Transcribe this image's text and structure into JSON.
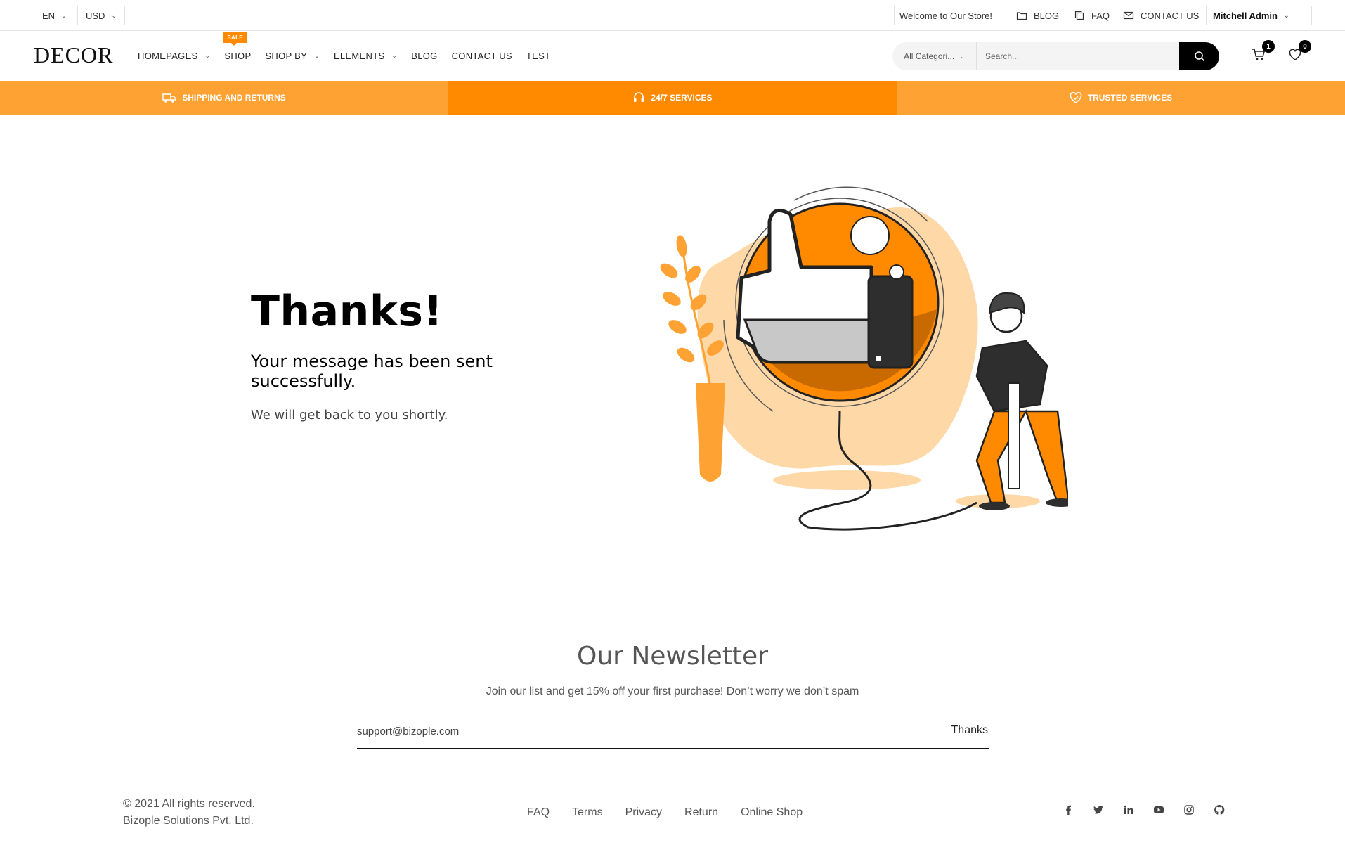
{
  "topbar": {
    "language": "EN",
    "currency": "USD",
    "welcome": "Welcome to Our Store!",
    "blog": "BLOG",
    "faq": "FAQ",
    "contact": "CONTACT US",
    "user": "Mitchell Admin"
  },
  "header": {
    "logo": "DECOR",
    "nav": [
      {
        "label": "HOMEPAGES",
        "dropdown": true
      },
      {
        "label": "SHOP",
        "badge": "SALE"
      },
      {
        "label": "SHOP BY",
        "dropdown": true
      },
      {
        "label": "ELEMENTS",
        "dropdown": true
      },
      {
        "label": "BLOG"
      },
      {
        "label": "CONTACT US"
      },
      {
        "label": "TEST"
      }
    ],
    "search": {
      "category": "All Categori...",
      "placeholder": "Search..."
    },
    "cart_count": "1",
    "wishlist_count": "0"
  },
  "services": [
    "SHIPPING AND RETURNS",
    "24/7 SERVICES",
    "TRUSTED SERVICES"
  ],
  "hero": {
    "title": "Thanks!",
    "message": "Your message has been sent successfully.",
    "sub": "We will get back to you shortly."
  },
  "newsletter": {
    "title": "Our Newsletter",
    "subtitle": "Join our list and get 15% off your first purchase! Don’t worry we don’t spam",
    "email_value": "support@bizople.com",
    "button": "Thanks"
  },
  "footer": {
    "copyright_1": "© 2021 All rights reserved.",
    "copyright_2": "Bizople Solutions Pvt. Ltd.",
    "links": [
      "FAQ",
      "Terms",
      "Privacy",
      "Return",
      "Online Shop"
    ],
    "social": [
      "facebook-icon",
      "twitter-icon",
      "linkedin-icon",
      "youtube-icon",
      "instagram-icon",
      "github-icon"
    ]
  },
  "colors": {
    "accent": "#ff8a00",
    "accent_light": "#ffa234",
    "illustration_light": "#ffd8a8"
  }
}
